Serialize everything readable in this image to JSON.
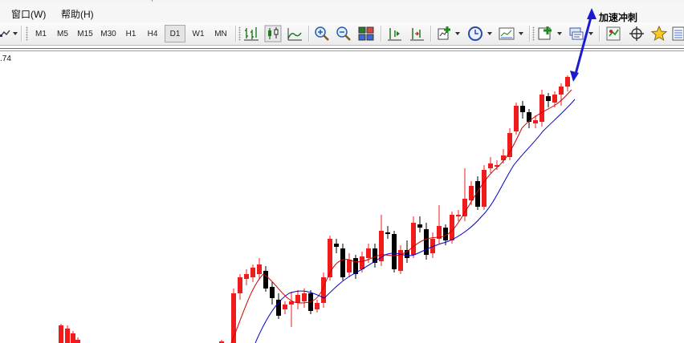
{
  "window": {
    "title_fragment": ", "
  },
  "menu": {
    "items": [
      {
        "key": "window",
        "label": "窗口(W)"
      },
      {
        "key": "help",
        "label": "帮助(H)"
      }
    ]
  },
  "toolbar": {
    "timeframes": [
      "M1",
      "M5",
      "M15",
      "M30",
      "H1",
      "H4",
      "D1",
      "W1",
      "MN"
    ],
    "active_timeframe": "D1",
    "icons": [
      "drawing-tools-icon",
      "bar-chart-icon",
      "candlestick-chart-icon",
      "line-chart-icon",
      "zoom-in-icon",
      "zoom-out-icon",
      "tile-windows-icon",
      "chart-shift-icon",
      "auto-scroll-icon",
      "indicators-icon",
      "periods-clock-icon",
      "templates-icon",
      "new-order-icon",
      "terminal-window-icon",
      "market-watch-icon",
      "crosshair-icon",
      "favorites-icon",
      "data-window-icon"
    ]
  },
  "chart": {
    "price_label": ".74",
    "annotation": "加速冲刺",
    "colors": {
      "bull": "#ee1c1c",
      "bear": "#000000",
      "ma_fast": "#d20000",
      "ma_slow": "#0000cc",
      "arrow": "#1a1acf"
    }
  }
}
